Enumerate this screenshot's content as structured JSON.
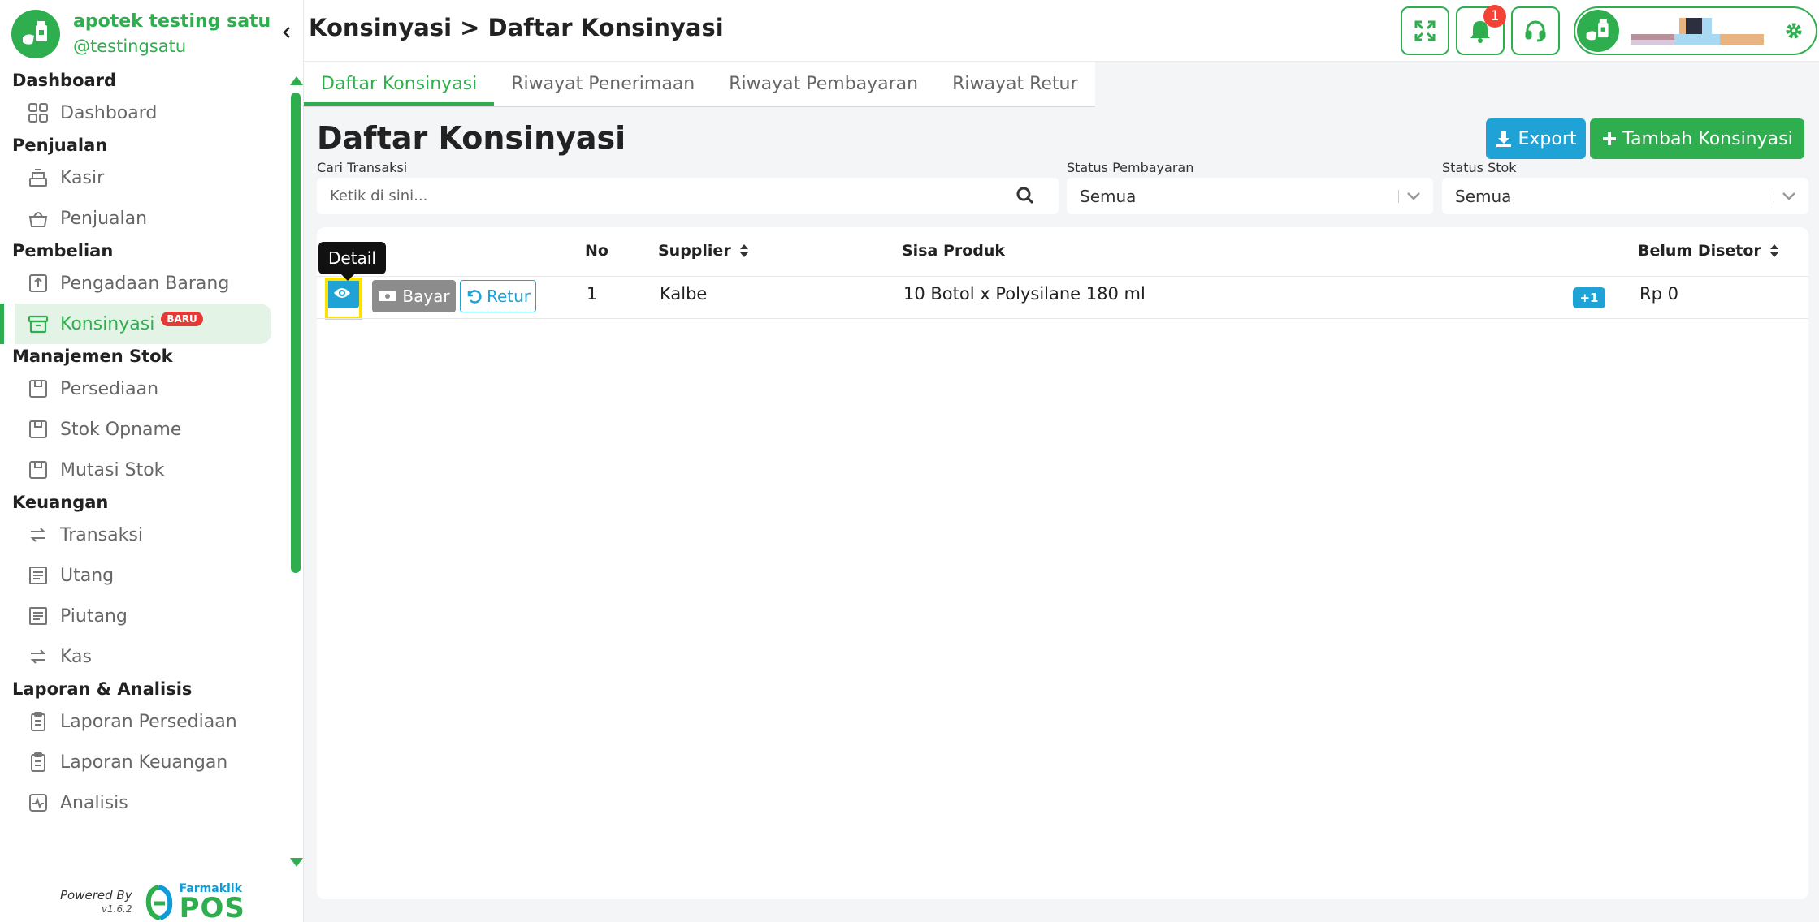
{
  "brand": {
    "name": "apotek testing satu",
    "handle": "@testingsatu"
  },
  "sidebar": {
    "sections": [
      {
        "title": "Dashboard",
        "items": [
          {
            "label": "Dashboard",
            "icon": "grid-icon"
          }
        ]
      },
      {
        "title": "Penjualan",
        "items": [
          {
            "label": "Kasir",
            "icon": "cash-register-icon"
          },
          {
            "label": "Penjualan",
            "icon": "basket-icon"
          }
        ]
      },
      {
        "title": "Pembelian",
        "items": [
          {
            "label": "Pengadaan Barang",
            "icon": "box-upload-icon"
          },
          {
            "label": "Konsinyasi",
            "icon": "archive-icon",
            "badge": "BARU",
            "active": true
          }
        ]
      },
      {
        "title": "Manajemen Stok",
        "items": [
          {
            "label": "Persediaan",
            "icon": "box-icon"
          },
          {
            "label": "Stok Opname",
            "icon": "box-icon"
          },
          {
            "label": "Mutasi Stok",
            "icon": "box-icon"
          }
        ]
      },
      {
        "title": "Keuangan",
        "items": [
          {
            "label": "Transaksi",
            "icon": "transfer-icon"
          },
          {
            "label": "Utang",
            "icon": "receipt-icon"
          },
          {
            "label": "Piutang",
            "icon": "receipt-icon"
          },
          {
            "label": "Kas",
            "icon": "transfer-icon"
          }
        ]
      },
      {
        "title": "Laporan & Analisis",
        "items": [
          {
            "label": "Laporan Persediaan",
            "icon": "clipboard-icon"
          },
          {
            "label": "Laporan Keuangan",
            "icon": "clipboard-icon"
          },
          {
            "label": "Analisis",
            "icon": "activity-icon"
          }
        ]
      }
    ]
  },
  "footer": {
    "powered_by": "Powered By",
    "version": "v1.6.2",
    "logo_small": "Farmaklik",
    "logo_big": "POS"
  },
  "header": {
    "title": "Konsinyasi > Daftar Konsinyasi",
    "notification_count": "1"
  },
  "tabs": [
    {
      "label": "Daftar Konsinyasi",
      "active": true
    },
    {
      "label": "Riwayat Penerimaan"
    },
    {
      "label": "Riwayat Pembayaran"
    },
    {
      "label": "Riwayat Retur"
    }
  ],
  "content": {
    "title": "Daftar Konsinyasi",
    "export_label": "Export",
    "add_label": "Tambah Konsinyasi",
    "search": {
      "label": "Cari Transaksi",
      "placeholder": "Ketik di sini..."
    },
    "status_pembayaran": {
      "label": "Status Pembayaran",
      "value": "Semua"
    },
    "status_stok": {
      "label": "Status Stok",
      "value": "Semua"
    }
  },
  "table": {
    "headers": {
      "no": "No",
      "supplier": "Supplier",
      "sisa_produk": "Sisa Produk",
      "belum_disetor": "Belum Disetor"
    },
    "tooltip": "Detail",
    "rows": [
      {
        "no": "1",
        "supplier": "Kalbe",
        "sisa_produk": "10 Botol x Polysilane 180 ml",
        "extra_badge": "+1",
        "belum_disetor": "Rp 0",
        "bayar_label": "Bayar",
        "retur_label": "Retur"
      }
    ]
  },
  "colors": {
    "primary": "#2eae4e",
    "info": "#1fa3d6",
    "danger": "#f44336",
    "highlight": "#ffe100"
  }
}
